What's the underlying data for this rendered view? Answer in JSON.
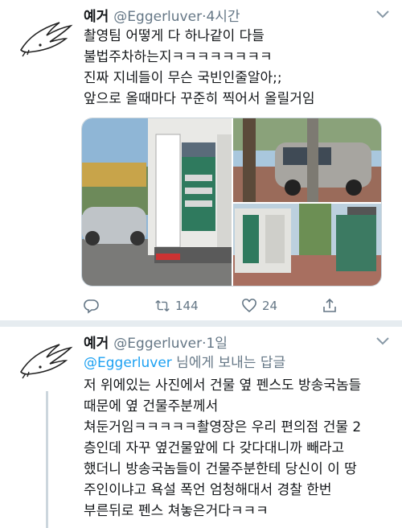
{
  "tweet1": {
    "name": "예거",
    "handle": "@Eggerluver",
    "time": "·4시간",
    "lines": [
      "촬영팀 어떻게 다 하나같이 다들",
      "불법주차하는지ㅋㅋㅋㅋㅋㅋㅋㅋ",
      "진짜 지네들이 무슨 국빈인줄알아;;",
      "앞으로 올때마다 꾸준히 찍어서 올릴거임"
    ],
    "actions": {
      "reply_count": "",
      "retweet_count": "144",
      "like_count": "24"
    }
  },
  "tweet2": {
    "name": "예거",
    "handle": "@Eggerluver",
    "time": "·1일",
    "reply_mention": "@Eggerluver",
    "reply_suffix": " 님에게 보내는 답글",
    "lines": [
      "저 위에있는 사진에서 건물 옆 펜스도 방송국놈들",
      "때문에 옆 건물주분께서",
      "쳐둔거임ㅋㅋㅋㅋㅋ촬영장은 우리 편의점 건물 2",
      "층인데 자꾸 옆건물앞에 다 갖다대니까 빼라고",
      "했더니 방송국놈들이 건물주분한테 당신이 이 땅",
      "주인이냐고 욕설 폭언 엄청해대서 경찰 한번",
      "부른뒤로 펜스 쳐놓은거다ㅋㅋㅋ"
    ]
  },
  "colors": {
    "accent": "#1da1f2",
    "muted": "#657786",
    "text": "#14171a",
    "divider": "#e6ecf0"
  },
  "icons": [
    "avatar-doodle",
    "chevron-down-icon",
    "reply-icon",
    "retweet-icon",
    "like-icon",
    "share-icon"
  ]
}
